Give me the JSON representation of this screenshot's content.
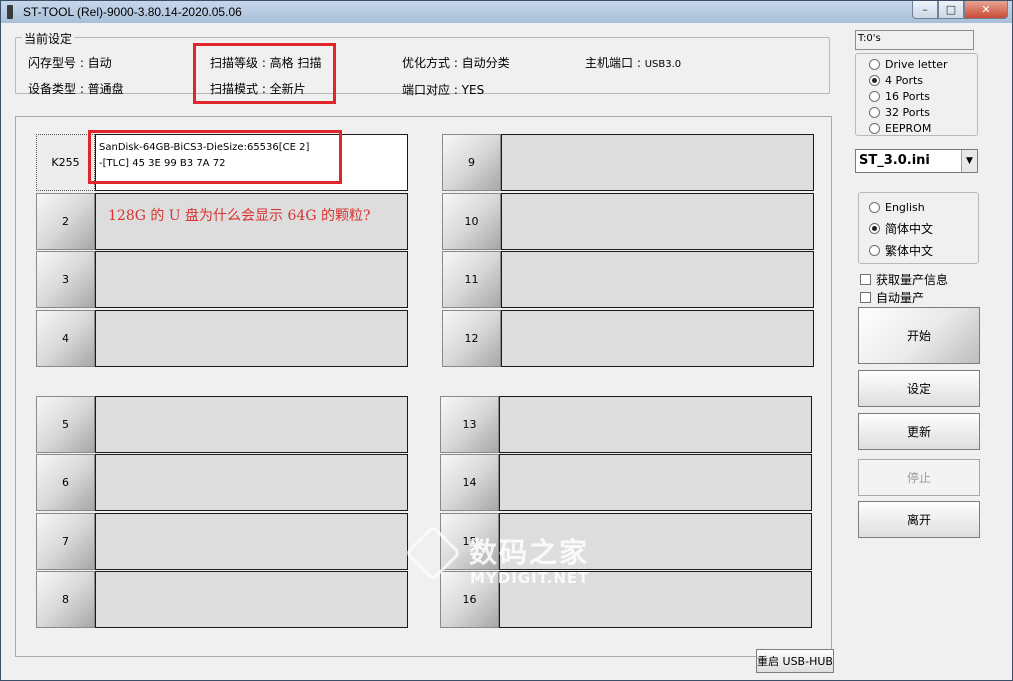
{
  "window": {
    "title": "ST-TOOL (Rel)-9000-3.80.14-2020.05.06",
    "minimize": "–",
    "maximize": "□",
    "close": "✕"
  },
  "current_settings": {
    "title": "当前设定",
    "flash_model": "闪存型号 : 自动",
    "device_type": "设备类型 : 普通盘",
    "scan_level": "扫描等级 : 高格 扫描",
    "scan_mode": "扫描模式 : 全新片",
    "optimize": "优化方式 : 自动分类",
    "port_map": "端口对应 : YES",
    "host_port_label": "主机端口 : ",
    "host_port_value": "USB3.0"
  },
  "ports": {
    "left_top": [
      {
        "label": "K255",
        "line1": "SanDisk-64GB-BiCS3-DieSize:65536[CE 2]",
        "line2": "-[TLC] 45 3E 99 B3 7A 72"
      },
      {
        "label": "2"
      },
      {
        "label": "3"
      },
      {
        "label": "4"
      }
    ],
    "right_top": [
      {
        "label": "9"
      },
      {
        "label": "10"
      },
      {
        "label": "11"
      },
      {
        "label": "12"
      }
    ],
    "left_bottom": [
      {
        "label": "5"
      },
      {
        "label": "6"
      },
      {
        "label": "7"
      },
      {
        "label": "8"
      }
    ],
    "right_bottom": [
      {
        "label": "13"
      },
      {
        "label": "14"
      },
      {
        "label": "15"
      },
      {
        "label": "16"
      }
    ]
  },
  "annotation": "128G 的 U 盘为什么会显示 64G 的颗粒?",
  "watermark": {
    "line1": "数码之家",
    "line2": "MYDIGIT.NET"
  },
  "right_panel": {
    "timer": "T:0's",
    "port_options": [
      {
        "label": "Drive letter",
        "selected": false
      },
      {
        "label": "4 Ports",
        "selected": true
      },
      {
        "label": "16 Ports",
        "selected": false
      },
      {
        "label": "32 Ports",
        "selected": false
      },
      {
        "label": "EEPROM",
        "selected": false
      }
    ],
    "ini_select": "ST_3.0.ini",
    "languages": [
      {
        "label": "English",
        "selected": false
      },
      {
        "label": "简体中文",
        "selected": true
      },
      {
        "label": "繁体中文",
        "selected": false
      }
    ],
    "get_mp_info": "获取量产信息",
    "auto_mp": "自动量产",
    "start": "开始",
    "settings": "设定",
    "update": "更新",
    "stop": "停止",
    "exit": "离开",
    "restart_hub": "重启 USB-HUB"
  },
  "colors": {
    "highlight_red": "#e0262a",
    "annotation_red": "#d8342f"
  }
}
